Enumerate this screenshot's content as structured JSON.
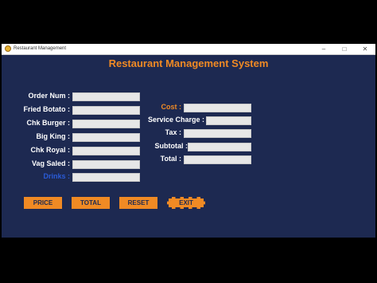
{
  "window": {
    "title": "Restaurant Management"
  },
  "heading": "Restaurant Management System",
  "left_fields": [
    {
      "label": "Order Num :",
      "value": ""
    },
    {
      "label": "Fried Botato :",
      "value": ""
    },
    {
      "label": "Chk Burger :",
      "value": ""
    },
    {
      "label": "Big King :",
      "value": ""
    },
    {
      "label": "Chk Royal :",
      "value": ""
    },
    {
      "label": "Vag Saled :",
      "value": ""
    },
    {
      "label": "Drinks :",
      "value": ""
    }
  ],
  "right_fields": [
    {
      "label": "Cost :",
      "value": ""
    },
    {
      "label": "Service Charge :",
      "value": ""
    },
    {
      "label": "Tax :",
      "value": ""
    },
    {
      "label": "Subtotal :",
      "value": ""
    },
    {
      "label": "Total :",
      "value": ""
    }
  ],
  "buttons": {
    "price": "PRICE",
    "total": "TOTAL",
    "reset": "RESET",
    "exit": "EXIT"
  },
  "colors": {
    "background": "#1d2951",
    "accent": "#f08a24",
    "drinks_label": "#2a5bd7"
  },
  "icons": {
    "app": "restaurant-app-icon",
    "minimize": "minimize-icon",
    "maximize": "maximize-icon",
    "close": "close-icon"
  }
}
